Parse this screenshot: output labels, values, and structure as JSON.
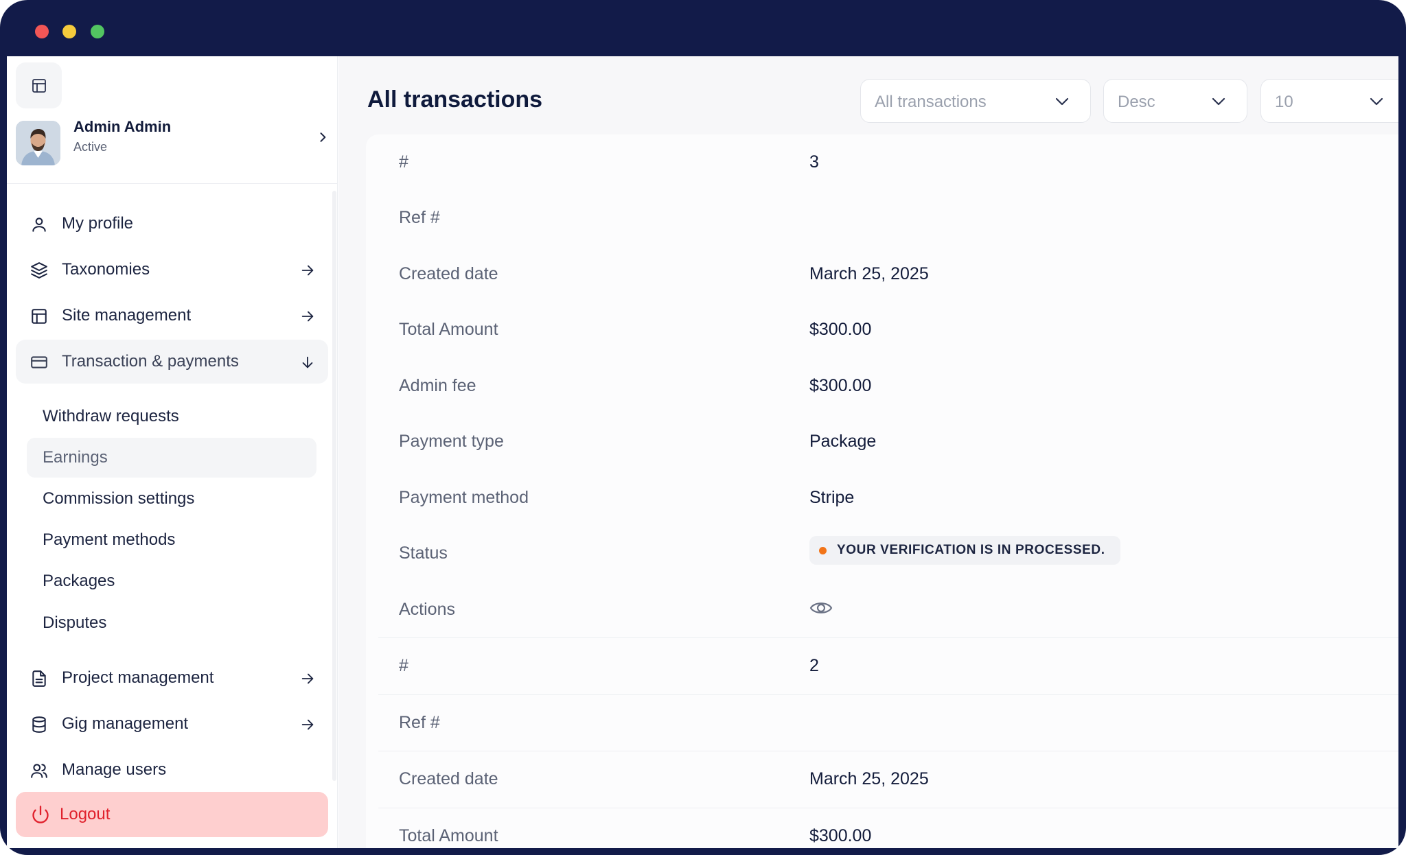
{
  "window": {
    "controls": [
      "close",
      "minimize",
      "maximize"
    ]
  },
  "sidebar": {
    "toggle_icon": "panel-layout-icon",
    "user": {
      "name": "Admin Admin",
      "status": "Active"
    },
    "items": [
      {
        "label": "My profile",
        "icon": "user-icon"
      },
      {
        "label": "Taxonomies",
        "icon": "layers-icon"
      },
      {
        "label": "Site management",
        "icon": "layout-icon"
      },
      {
        "label": "Transaction & payments",
        "icon": "credit-card-icon"
      },
      {
        "label": "Project management",
        "icon": "document-icon"
      },
      {
        "label": "Gig management",
        "icon": "database-icon"
      },
      {
        "label": "Manage users",
        "icon": "users-icon"
      }
    ],
    "sub_items": [
      {
        "label": "Withdraw requests"
      },
      {
        "label": "Earnings"
      },
      {
        "label": "Commission settings"
      },
      {
        "label": "Payment methods"
      },
      {
        "label": "Packages"
      },
      {
        "label": "Disputes"
      }
    ],
    "logout": {
      "label": "Logout"
    }
  },
  "main": {
    "title": "All transactions",
    "filters": {
      "type": "All transactions",
      "order": "Desc",
      "per_page": "10"
    },
    "records": [
      {
        "id": "3",
        "ref": "",
        "created_date": "March 25, 2025",
        "total_amount": "$300.00",
        "admin_fee": "$300.00",
        "payment_type": "Package",
        "payment_method": "Stripe",
        "status": "YOUR VERIFICATION IS IN PROCESSED."
      },
      {
        "id": "2",
        "ref": "",
        "created_date": "March 25, 2025",
        "total_amount": "$300.00"
      }
    ],
    "labels": {
      "id": "#",
      "ref": "Ref #",
      "created_date": "Created date",
      "total_amount": "Total Amount",
      "admin_fee": "Admin fee",
      "payment_type": "Payment type",
      "payment_method": "Payment method",
      "status": "Status",
      "actions": "Actions"
    }
  },
  "colors": {
    "frame": "#121b49",
    "accent_danger": "#e0202c",
    "status_dot": "#f27418"
  }
}
